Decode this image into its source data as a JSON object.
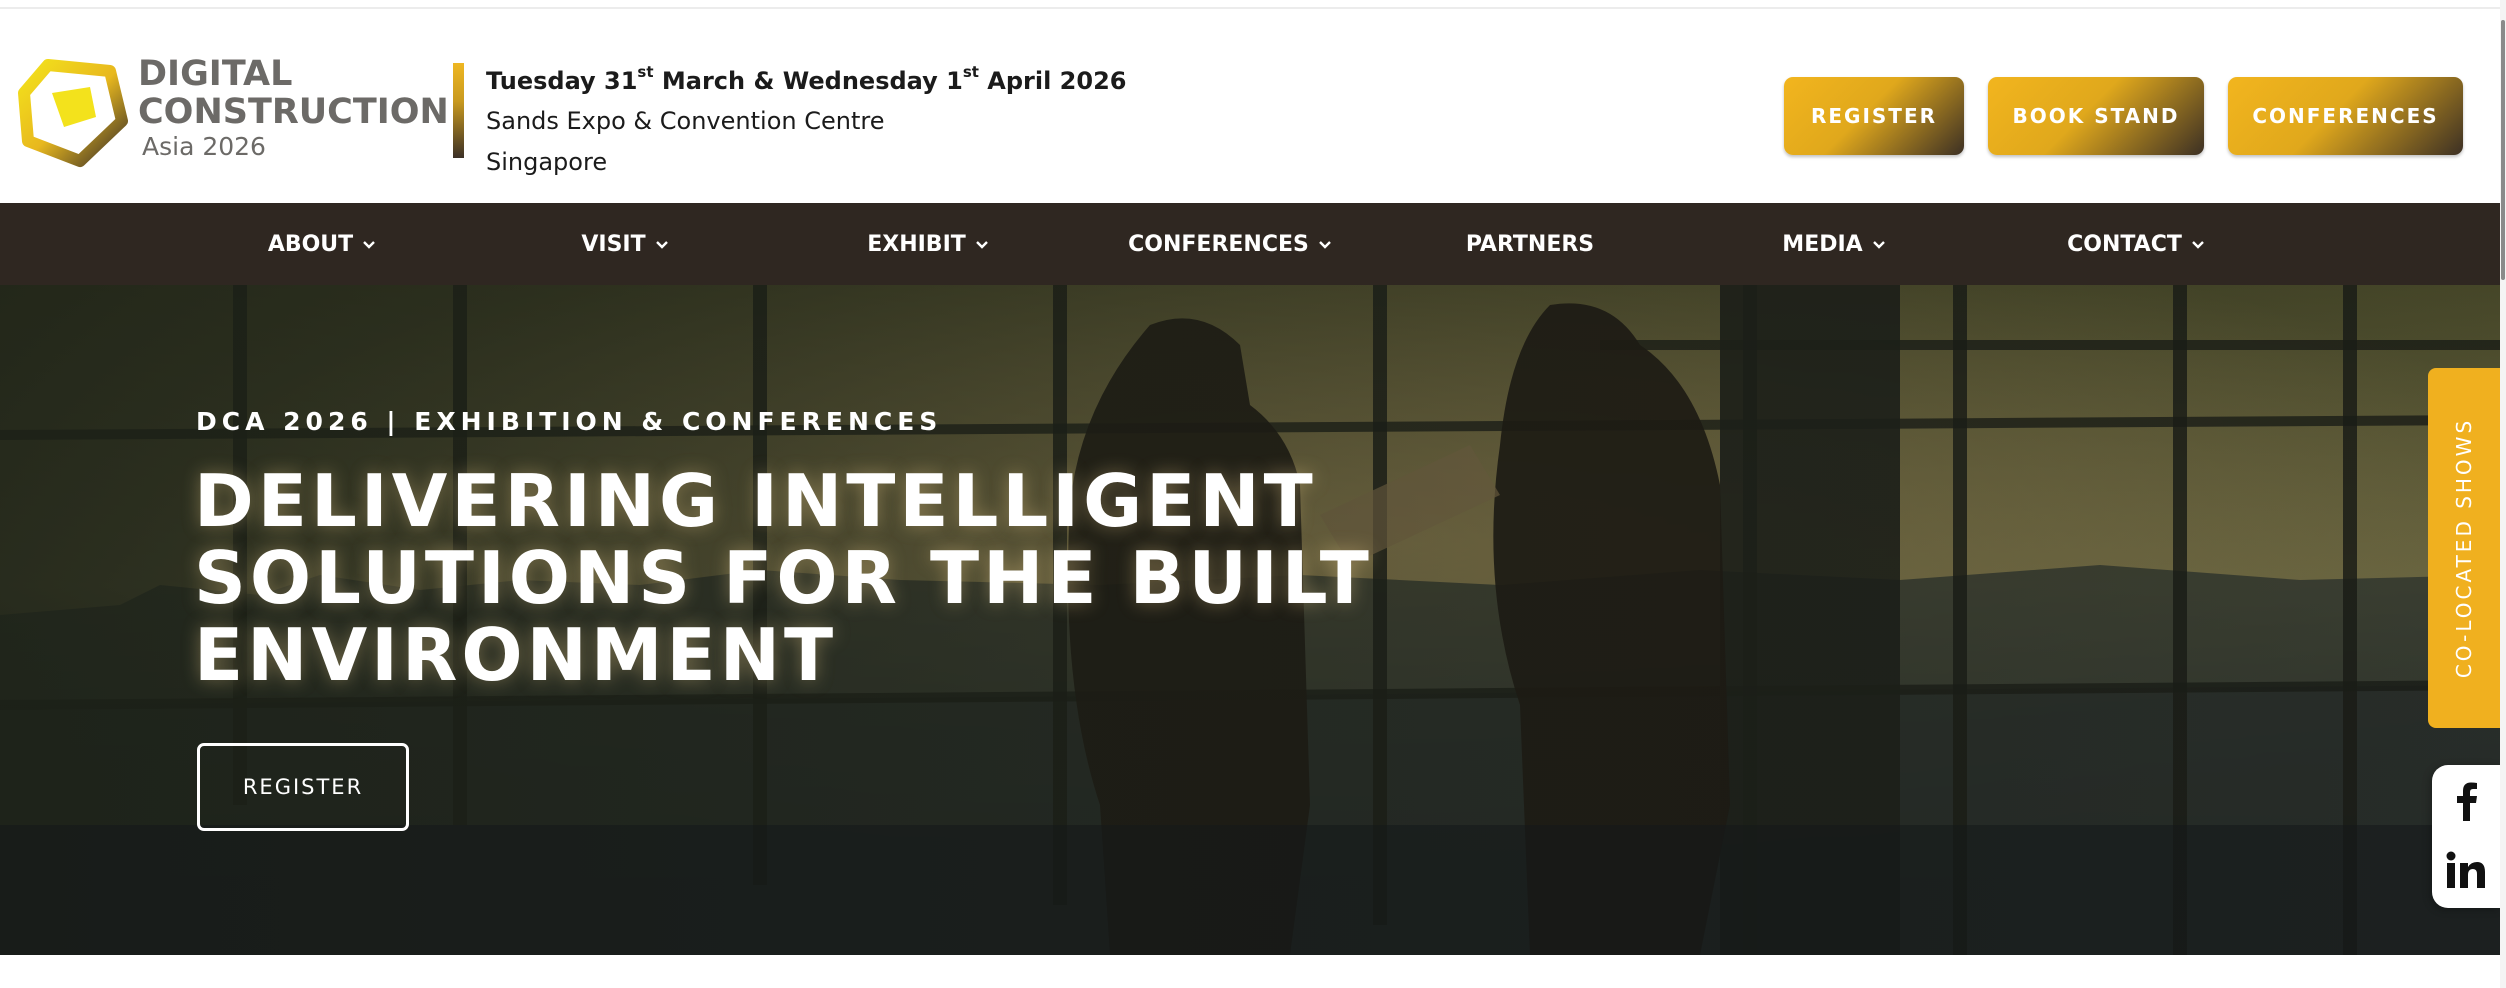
{
  "header": {
    "logo": {
      "line1": "DIGITAL",
      "line2": "CONSTRUCTION",
      "line3": "Asia 2026"
    },
    "event": {
      "day1": "Tuesday 31",
      "day1_suffix": "st",
      "mid": " March & Wednesday 1",
      "day2_suffix": "st",
      "end": " April 2026",
      "venue": "Sands Expo & Convention Centre",
      "city": "Singapore"
    },
    "buttons": {
      "register": "REGISTER",
      "book_stand": "BOOK STAND",
      "conferences": "CONFERENCES"
    }
  },
  "nav": {
    "about": "ABOUT",
    "visit": "VISIT",
    "exhibit": "EXHIBIT",
    "conferences": "CONFERENCES",
    "partners": "PARTNERS",
    "media": "MEDIA",
    "contact": "CONTACT"
  },
  "hero": {
    "kicker": "DCA 2026 | EXHIBITION & CONFERENCES",
    "title_line1": "DELIVERING INTELLIGENT",
    "title_line2": "SOLUTIONS FOR THE BUILT",
    "title_line3": "ENVIRONMENT",
    "cta": "REGISTER"
  },
  "sidebar": {
    "colocated": "CO-LOCATED SHOWS",
    "social": [
      "facebook-icon",
      "linkedin-icon"
    ]
  },
  "colors": {
    "gold": "#f0b01f",
    "dark_nav": "#2f2721",
    "logo_gray": "#6c6a67"
  }
}
